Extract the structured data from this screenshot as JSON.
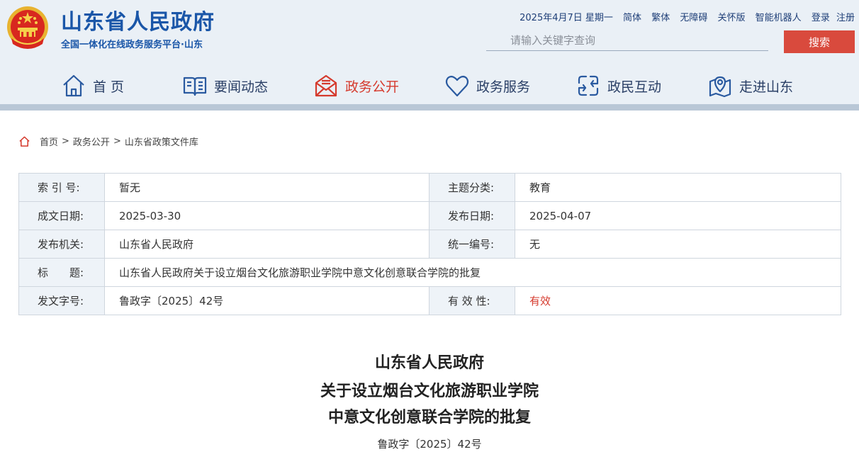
{
  "header": {
    "site_title": "山东省人民政府",
    "site_subtitle": "全国一体化在线政务服务平台·山东",
    "date": "2025年4月7日 星期一",
    "links": [
      "简体",
      "繁体",
      "无障碍",
      "关怀版",
      "智能机器人",
      "登录",
      "注册"
    ],
    "search_placeholder": "请输入关键字查询",
    "search_button": "搜索"
  },
  "nav": {
    "items": [
      {
        "label": "首 页",
        "icon": "home-icon"
      },
      {
        "label": "要闻动态",
        "icon": "book-icon"
      },
      {
        "label": "政务公开",
        "icon": "mail-icon"
      },
      {
        "label": "政务服务",
        "icon": "heart-icon"
      },
      {
        "label": "政民互动",
        "icon": "exchange-icon"
      },
      {
        "label": "走进山东",
        "icon": "map-pin-icon"
      }
    ],
    "active_index": 2
  },
  "breadcrumb": [
    "首页",
    "政务公开",
    "山东省政策文件库"
  ],
  "meta": {
    "index_label": "索 引 号:",
    "index_value": "暂无",
    "topic_label": "主题分类:",
    "topic_value": "教育",
    "created_label": "成文日期:",
    "created_value": "2025-03-30",
    "published_label": "发布日期:",
    "published_value": "2025-04-07",
    "issuer_label": "发布机关:",
    "issuer_value": "山东省人民政府",
    "code_label": "统一编号:",
    "code_value": "无",
    "title_label": "标　　题:",
    "title_value": "山东省人民政府关于设立烟台文化旅游职业学院中意文化创意联合学院的批复",
    "docno_label": "发文字号:",
    "docno_value": "鲁政字〔2025〕42号",
    "validity_label": "有 效 性:",
    "validity_value": "有效"
  },
  "document": {
    "title_lines": [
      "山东省人民政府",
      "关于设立烟台文化旅游职业学院",
      "中意文化创意联合学院的批复"
    ],
    "doc_number": "鲁政字〔2025〕42号"
  },
  "colors": {
    "brand_blue": "#1a56a8",
    "accent_red": "#d94a3d",
    "nav_text": "#2a3f66"
  }
}
